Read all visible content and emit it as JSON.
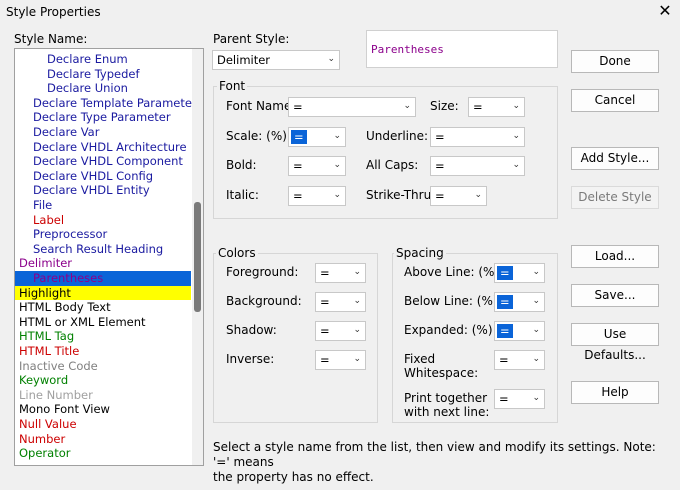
{
  "window": {
    "title": "Style Properties",
    "close_glyph": "✕"
  },
  "style_list": {
    "label": "Style Name:",
    "items": [
      {
        "label": "Declare Enum",
        "color": "#1a1aa0",
        "indent": 2
      },
      {
        "label": "Declare Typedef",
        "color": "#1a1aa0",
        "indent": 2
      },
      {
        "label": "Declare Union",
        "color": "#1a1aa0",
        "indent": 2
      },
      {
        "label": "Declare Template Parameter",
        "color": "#1a1aa0",
        "indent": 1
      },
      {
        "label": "Declare Type Parameter",
        "color": "#1a1aa0",
        "indent": 1
      },
      {
        "label": "Declare Var",
        "color": "#1a1aa0",
        "indent": 1
      },
      {
        "label": "Declare VHDL Architecture",
        "color": "#1a1aa0",
        "indent": 1
      },
      {
        "label": "Declare VHDL Component",
        "color": "#1a1aa0",
        "indent": 1
      },
      {
        "label": "Declare VHDL Config",
        "color": "#1a1aa0",
        "indent": 1
      },
      {
        "label": "Declare VHDL Entity",
        "color": "#1a1aa0",
        "indent": 1
      },
      {
        "label": "File",
        "color": "#1a1aa0",
        "indent": 1
      },
      {
        "label": "Label",
        "color": "#cc0000",
        "indent": 1
      },
      {
        "label": "Preprocessor",
        "color": "#1a1aa0",
        "indent": 1
      },
      {
        "label": "Search Result Heading",
        "color": "#1a1aa0",
        "indent": 1
      },
      {
        "label": "Delimiter",
        "color": "#8b008b",
        "indent": 0
      },
      {
        "label": "Parentheses",
        "color": "#8b008b",
        "indent": 1,
        "selected": true
      },
      {
        "label": "Highlight",
        "color": "#000000",
        "indent": 0,
        "bg": "#ffff00"
      },
      {
        "label": "HTML Body Text",
        "color": "#000000",
        "indent": 0
      },
      {
        "label": "HTML or XML Element",
        "color": "#000000",
        "indent": 0
      },
      {
        "label": "HTML Tag",
        "color": "#008000",
        "indent": 0
      },
      {
        "label": "HTML Title",
        "color": "#cc0000",
        "indent": 0
      },
      {
        "label": "Inactive Code",
        "color": "#808080",
        "indent": 0
      },
      {
        "label": "Keyword",
        "color": "#008000",
        "indent": 0
      },
      {
        "label": "Line Number",
        "color": "#a0a0a0",
        "indent": 0
      },
      {
        "label": "Mono Font View",
        "color": "#000000",
        "indent": 0
      },
      {
        "label": "Null Value",
        "color": "#cc0000",
        "indent": 0
      },
      {
        "label": "Number",
        "color": "#cc0000",
        "indent": 0
      },
      {
        "label": "Operator",
        "color": "#008000",
        "indent": 0
      }
    ]
  },
  "parent_style": {
    "label": "Parent Style:",
    "value": "Delimiter"
  },
  "preview": {
    "text": "Parentheses"
  },
  "font": {
    "title": "Font",
    "font_name": {
      "label": "Font Name:",
      "value": "="
    },
    "size": {
      "label": "Size:",
      "value": "="
    },
    "scale": {
      "label": "Scale: (%)",
      "value": "="
    },
    "underline": {
      "label": "Underline:",
      "value": "="
    },
    "bold": {
      "label": "Bold:",
      "value": "="
    },
    "all_caps": {
      "label": "All Caps:",
      "value": "="
    },
    "italic": {
      "label": "Italic:",
      "value": "="
    },
    "strike_thru": {
      "label": "Strike-Thru:",
      "value": "="
    }
  },
  "colors": {
    "title": "Colors",
    "foreground": {
      "label": "Foreground:",
      "value": "="
    },
    "background": {
      "label": "Background:",
      "value": "="
    },
    "shadow": {
      "label": "Shadow:",
      "value": "="
    },
    "inverse": {
      "label": "Inverse:",
      "value": "="
    }
  },
  "spacing": {
    "title": "Spacing",
    "above_line": {
      "label": "Above Line: (%)",
      "value": "="
    },
    "below_line": {
      "label": "Below Line: (%)",
      "value": "="
    },
    "expanded": {
      "label": "Expanded: (%)",
      "value": "="
    },
    "fixed_whitespace": {
      "label1": "Fixed",
      "label2": "Whitespace:",
      "value": "="
    },
    "print_together": {
      "label1": "Print together",
      "label2": "with next line:",
      "value": "="
    }
  },
  "buttons": {
    "done": "Done",
    "cancel": "Cancel",
    "add_style": "Add Style...",
    "delete_style": "Delete Style",
    "load": "Load...",
    "save": "Save...",
    "use_defaults": "Use Defaults...",
    "help": "Help"
  },
  "status": {
    "line1": "Select a style name from the list, then view and modify its settings. Note: '=' means",
    "line2": "the property has no effect."
  }
}
